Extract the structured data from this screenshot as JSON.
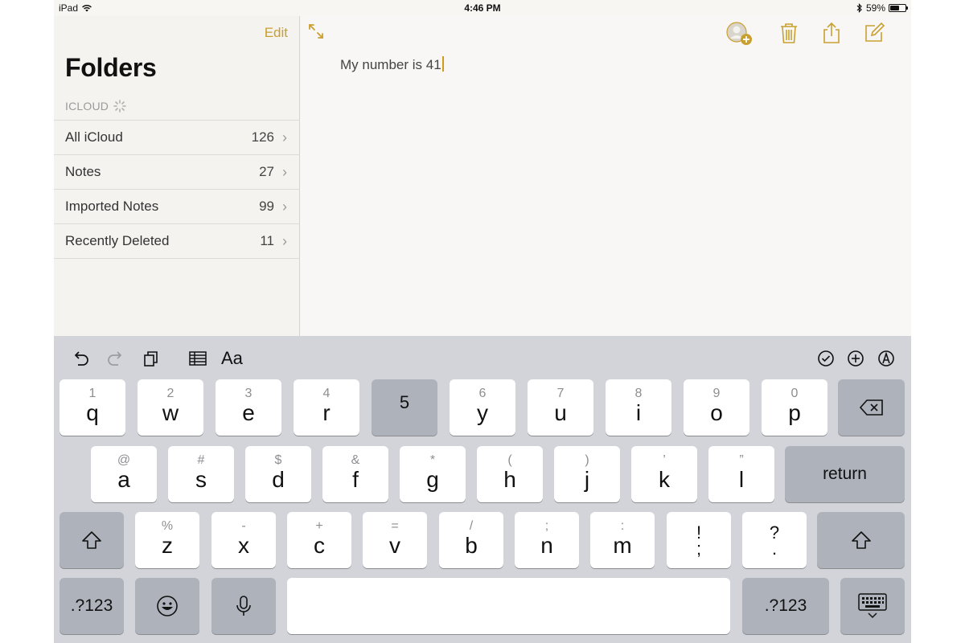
{
  "status_bar": {
    "device": "iPad",
    "time": "4:46 PM",
    "battery": "59%",
    "battery_level": 0.59,
    "icons": [
      "wifi-icon",
      "bluetooth-icon",
      "battery-icon"
    ]
  },
  "sidebar": {
    "edit_label": "Edit",
    "title": "Folders",
    "section_label": "ICLOUD",
    "folders": [
      {
        "name": "All iCloud",
        "count": "126"
      },
      {
        "name": "Notes",
        "count": "27"
      },
      {
        "name": "Imported Notes",
        "count": "99"
      },
      {
        "name": "Recently Deleted",
        "count": "11"
      }
    ]
  },
  "note": {
    "text": "My number is 41"
  },
  "toolbar": {
    "icons": [
      "expand-icon",
      "add-people-icon",
      "trash-icon",
      "share-icon",
      "compose-icon"
    ],
    "accent": "#c9a030"
  },
  "keyboard": {
    "shortcut_icons": [
      "undo-icon",
      "redo-icon",
      "paste-icon",
      "table-icon",
      "format-icon",
      "checklist-icon",
      "add-icon",
      "sketch-icon"
    ],
    "format_label": "Aa",
    "row1": [
      {
        "main": "q",
        "sub": "1"
      },
      {
        "main": "w",
        "sub": "2"
      },
      {
        "main": "e",
        "sub": "3"
      },
      {
        "main": "r",
        "sub": "4"
      },
      {
        "main": "5",
        "sub": ""
      },
      {
        "main": "y",
        "sub": "6"
      },
      {
        "main": "u",
        "sub": "7"
      },
      {
        "main": "i",
        "sub": "8"
      },
      {
        "main": "o",
        "sub": "9"
      },
      {
        "main": "p",
        "sub": "0"
      }
    ],
    "row2": [
      {
        "main": "a",
        "sub": "@"
      },
      {
        "main": "s",
        "sub": "#"
      },
      {
        "main": "d",
        "sub": "$"
      },
      {
        "main": "f",
        "sub": "&"
      },
      {
        "main": "g",
        "sub": "*"
      },
      {
        "main": "h",
        "sub": "("
      },
      {
        "main": "j",
        "sub": ")"
      },
      {
        "main": "k",
        "sub": "’"
      },
      {
        "main": "l",
        "sub": "”"
      }
    ],
    "row3": [
      {
        "main": "z",
        "sub": "%"
      },
      {
        "main": "x",
        "sub": "-"
      },
      {
        "main": "c",
        "sub": "+"
      },
      {
        "main": "v",
        "sub": "="
      },
      {
        "main": "b",
        "sub": "/"
      },
      {
        "main": "n",
        "sub": ";"
      },
      {
        "main": "m",
        "sub": ":"
      },
      {
        "main": ";",
        "sub": "!"
      },
      {
        "main": ".",
        "sub": "?"
      }
    ],
    "return_label": "return",
    "numbers_label": ".?123",
    "pressed_key": "5"
  }
}
